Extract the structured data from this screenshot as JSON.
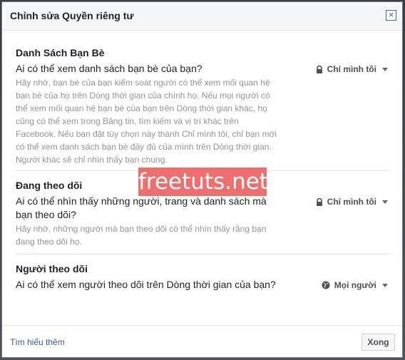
{
  "dialog": {
    "title": "Chỉnh sửa Quyền riêng tư",
    "close_label": "×"
  },
  "sections": [
    {
      "title": "Danh Sách Bạn Bè",
      "question": "Ai có thể xem danh sách bạn bè của bạn?",
      "description": "Hãy nhớ, bạn bè của bạn kiểm soát người có thể xem mối quan hệ bạn bè của họ trên Dòng thời gian của chính họ. Nếu mọi người có thể xem mối quan hệ bạn bè của bạn trên Dòng thời gian khác, họ cũng có thể xem trong Bảng tin, tìm kiếm và vị trí khác trên Facebook. Nếu bạn đặt tùy chọn này thành Chỉ mình tôi, chỉ bạn mới có thể xem danh sách bạn bè đầy đủ của mình trên Dòng thời gian. Người khác sẽ chỉ nhìn thấy bạn chung.",
      "privacy": "Chỉ mình tôi",
      "privacy_icon": "lock-icon"
    },
    {
      "title": "Đang theo dõi",
      "question": "Ai có thể nhìn thấy những người, trang và danh sách mà bạn theo dõi?",
      "description": "Hãy nhớ, những người mà bạn theo dõi có thể nhìn thấy rằng bạn đang theo dõi họ.",
      "privacy": "Chỉ mình tôi",
      "privacy_icon": "lock-icon"
    },
    {
      "title": "Người theo dõi",
      "question": "Ai có thể xem người theo dõi trên Dòng thời gian của bạn?",
      "privacy": "Mọi người",
      "privacy_icon": "globe-icon"
    }
  ],
  "footer": {
    "learn_more": "Tìm hiểu thêm",
    "done": "Xong"
  },
  "watermark": "freetuts.net",
  "colors": {
    "link": "#365899",
    "close_border": "#4267b2",
    "watermark_bg": "#ef6f6f"
  }
}
